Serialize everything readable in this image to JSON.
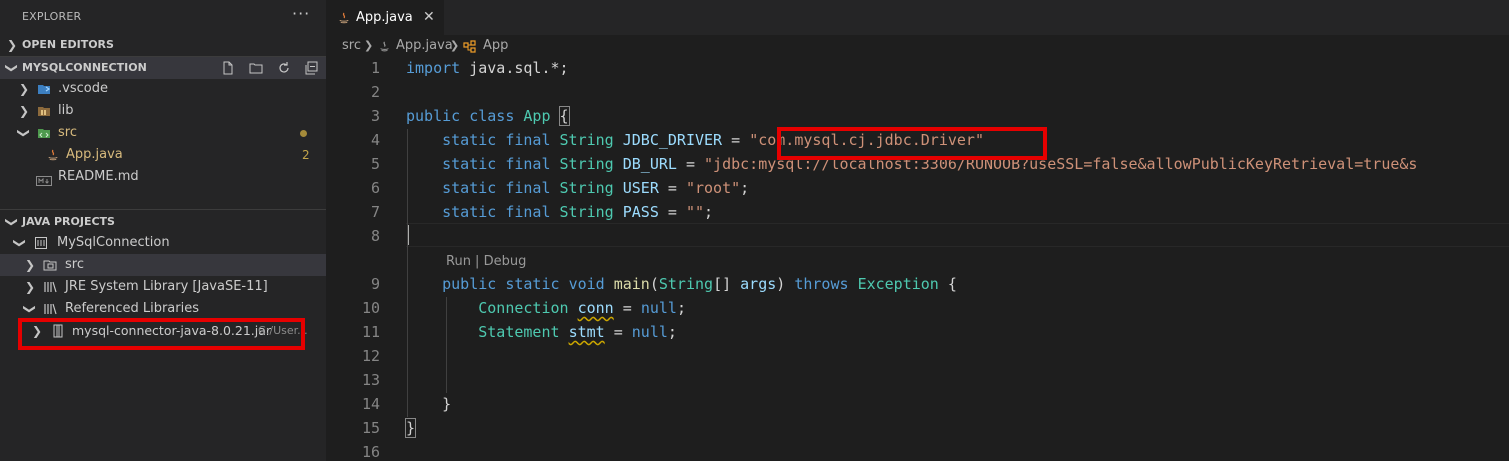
{
  "explorer": {
    "title": "EXPLORER",
    "more": "···",
    "open_editors": "OPEN EDITORS",
    "workspace": "MYSQLCONNECTION",
    "items": [
      {
        "label": ".vscode"
      },
      {
        "label": "lib"
      },
      {
        "label": "src"
      },
      {
        "label": "App.java",
        "badge": "2"
      },
      {
        "label": "README.md"
      }
    ]
  },
  "java_projects": {
    "title": "JAVA PROJECTS",
    "project": "MySqlConnection",
    "items": [
      {
        "label": "src"
      },
      {
        "label": "JRE System Library [JavaSE-11]"
      },
      {
        "label": "Referenced Libraries"
      },
      {
        "label": "mysql-connector-java-8.0.21.jar",
        "desc": "C:/User..."
      }
    ]
  },
  "tab": {
    "label": "App.java",
    "close": "✕"
  },
  "breadcrumb": [
    "src",
    "App.java",
    "App"
  ],
  "code_lens": "Run | Debug",
  "line_numbers": [
    "1",
    "2",
    "3",
    "4",
    "5",
    "6",
    "7",
    "8",
    "9",
    "10",
    "11",
    "12",
    "13",
    "14",
    "15",
    "16"
  ],
  "code": {
    "l1": {
      "kw": "import",
      "rest": " java.sql.*;"
    },
    "l3": {
      "kw1": "public",
      "kw2": "class",
      "cls": "App",
      "brace": "{"
    },
    "l4": {
      "mods": "static final",
      "type": "String",
      "name": "JDBC_DRIVER",
      "eq": " = ",
      "val": "\"com.mysql.cj.jdbc.Driver\""
    },
    "l5": {
      "mods": "static final",
      "type": "String",
      "name": "DB_URL",
      "eq": " = ",
      "val": "\"jdbc:mysql://localhost:3306/RUNOOB?useSSL=false&allowPublicKeyRetrieval=true&s"
    },
    "l6": {
      "mods": "static final",
      "type": "String",
      "name": "USER",
      "eq": " = ",
      "val": "\"root\"",
      "end": ";"
    },
    "l7": {
      "mods": "static final",
      "type": "String",
      "name": "PASS",
      "eq": " = ",
      "val": "\"\"",
      "end": ";"
    },
    "l9": {
      "mods": "public static",
      "ret": "void",
      "fn": "main",
      "ptype": "String",
      "arr": "[] ",
      "param": "args",
      "throws": "throws",
      "ex": "Exception",
      "brace": " {"
    },
    "l10": {
      "type": "Connection",
      "var": "conn",
      "eq": " = ",
      "nul": "null",
      "end": ";"
    },
    "l11": {
      "type": "Statement",
      "var": "stmt",
      "eq": " = ",
      "nul": "null",
      "end": ";"
    },
    "l14": {
      "brace": "}"
    },
    "l15": {
      "brace": "}"
    }
  },
  "colors": {
    "highlight_box": "#e60000",
    "selected_row": "#37373d"
  }
}
